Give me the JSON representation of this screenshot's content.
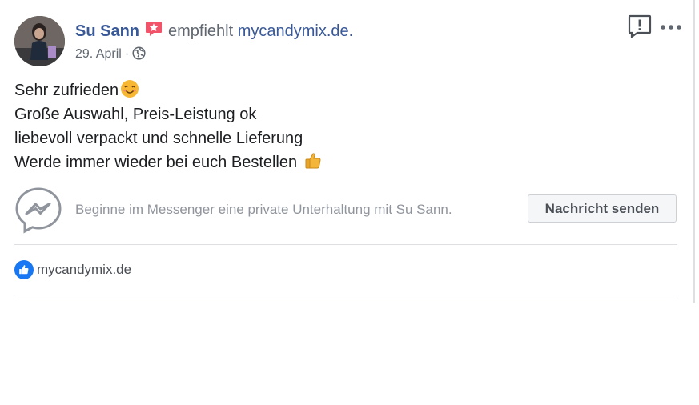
{
  "post": {
    "author_name": "Su Sann",
    "recommends_text": "empfiehlt",
    "page_name": "mycandymix.de.",
    "date": "29. April",
    "date_separator": "·",
    "body_lines": [
      "Sehr zufrieden",
      "Große Auswahl, Preis-Leistung ok",
      "liebevoll verpackt und schnelle Lieferung",
      "Werde immer wieder bei euch Bestellen "
    ]
  },
  "icons": {
    "recommend": "recommend-star-icon",
    "privacy": "globe-icon",
    "report": "report-icon",
    "more": "more-options-icon",
    "emoji_1": "smiling-face-icon",
    "emoji_2": "thumbs-up-icon",
    "messenger": "messenger-icon",
    "like": "like-icon"
  },
  "messenger": {
    "prompt": "Beginne im Messenger eine private Unterhaltung mit Su Sann.",
    "button_label": "Nachricht senden"
  },
  "footer": {
    "page_link": "mycandymix.de"
  },
  "colors": {
    "link": "#385898",
    "secondary_text": "#606770",
    "recommend_badge": "#f35369",
    "like_blue": "#1877f2"
  }
}
